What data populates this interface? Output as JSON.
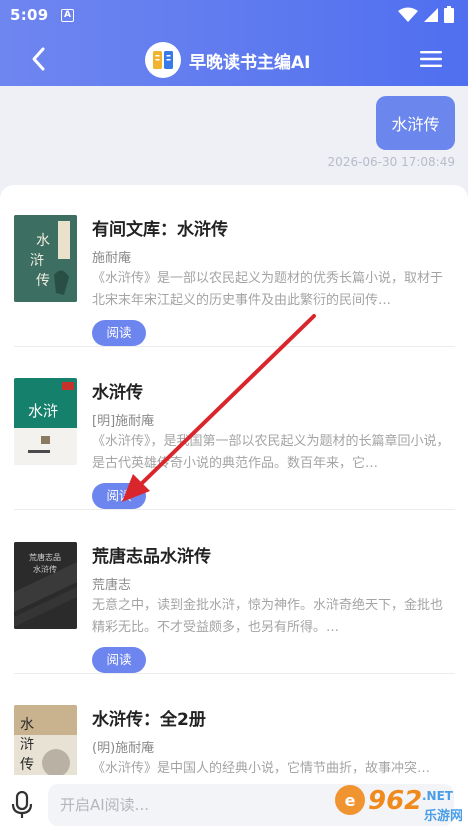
{
  "status_bar": {
    "time": "5:09",
    "badge": "A"
  },
  "header": {
    "title": "早晚读书主编AI",
    "back_icon": "back-arrow-icon",
    "menu_icon": "hamburger-menu-icon"
  },
  "chat": {
    "user_message": "水浒传",
    "timestamp": "2026-06-30 17:08:49"
  },
  "books": [
    {
      "title": "有间文库：水浒传",
      "author": "施耐庵",
      "description": "《水浒传》是一部以农民起义为题材的优秀长篇小说，取材于北宋末年宋江起义的历史事件及由此繁衍的民间传…",
      "read_label": "阅读",
      "cover_color": "#3c6e61"
    },
    {
      "title": "水浒传",
      "author": "[明]施耐庵",
      "description": "《水浒传》，是我国第一部以农民起义为题材的长篇章回小说，是古代英雄传奇小说的典范作品。数百年来，它…",
      "read_label": "阅读",
      "cover_color": "#f4f2ee"
    },
    {
      "title": "荒唐志品水浒传",
      "author": "荒唐志",
      "description": "无意之中，读到金批水浒，惊为神作。水浒奇绝天下，金批也精彩无比。不才受益颇多，也另有所得。…",
      "read_label": "阅读",
      "cover_color": "#2e2e2e"
    },
    {
      "title": "水浒传：全2册",
      "author": "(明)施耐庵",
      "description": "《水浒传》是中国人的经典小说，它情节曲折，故事冲突…",
      "read_label": "阅读",
      "cover_color": "#d9c9ae"
    }
  ],
  "input": {
    "placeholder": "开启AI阅读..."
  },
  "watermark": {
    "number": "962",
    "suffix": ".NET",
    "subtitle": "乐游网"
  },
  "colors": {
    "accent": "#6d86ef",
    "header_start": "#6f86f0",
    "header_end": "#4f6ff0",
    "arrow": "#d9262c"
  }
}
